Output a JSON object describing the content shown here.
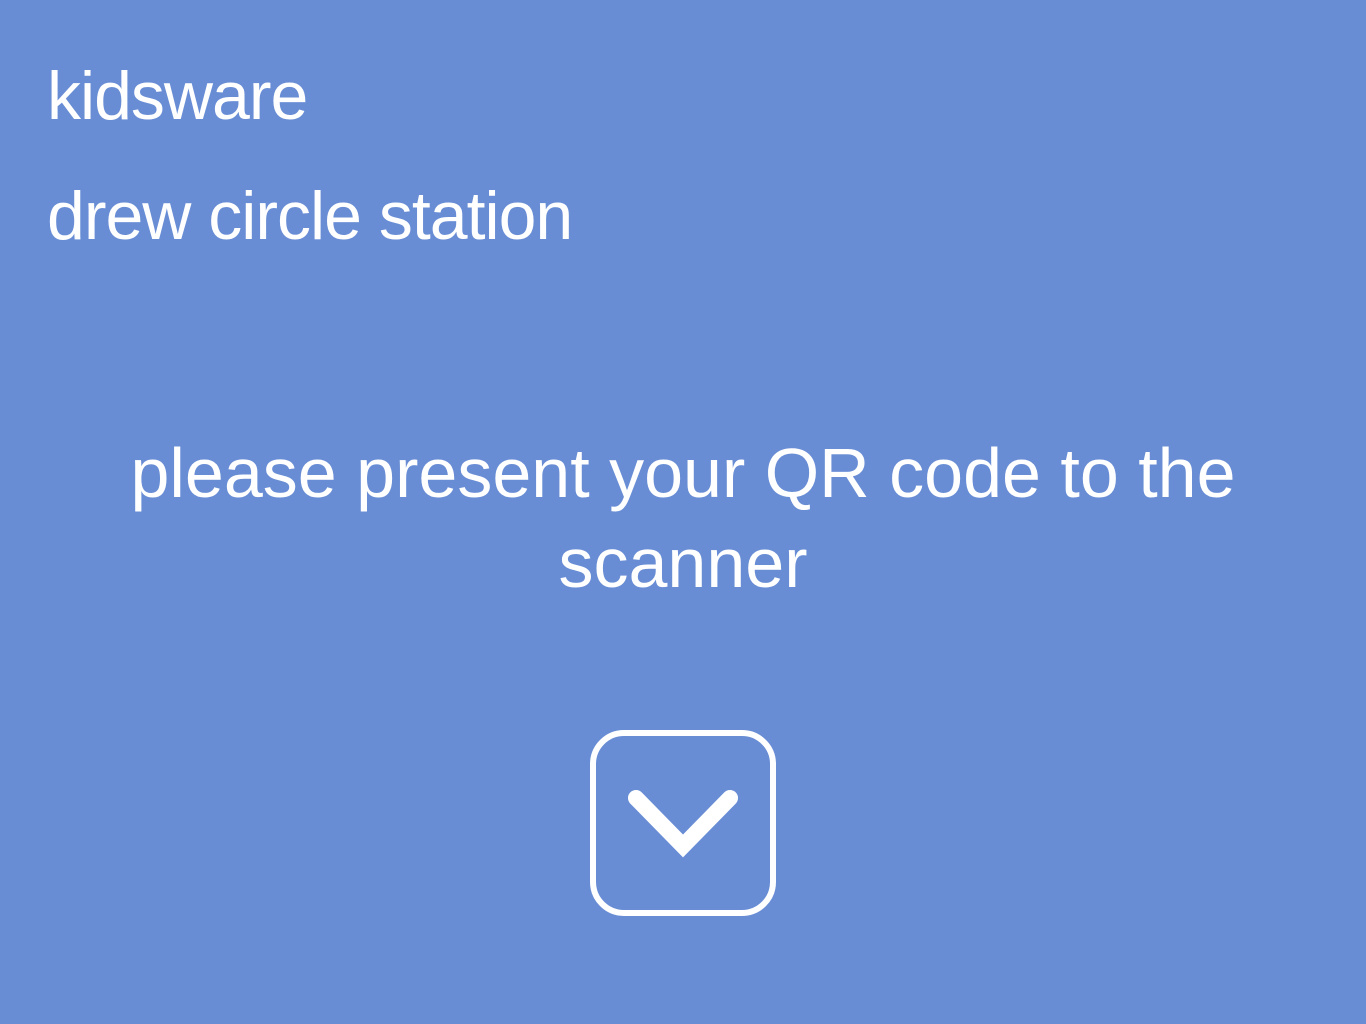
{
  "header": {
    "brand": "kidsware",
    "station": "drew circle station"
  },
  "main": {
    "prompt": "please present your QR code to the scanner"
  },
  "scan_button": {
    "icon": "chevron-down-icon"
  },
  "colors": {
    "background": "#688dd5",
    "text": "#ffffff"
  }
}
